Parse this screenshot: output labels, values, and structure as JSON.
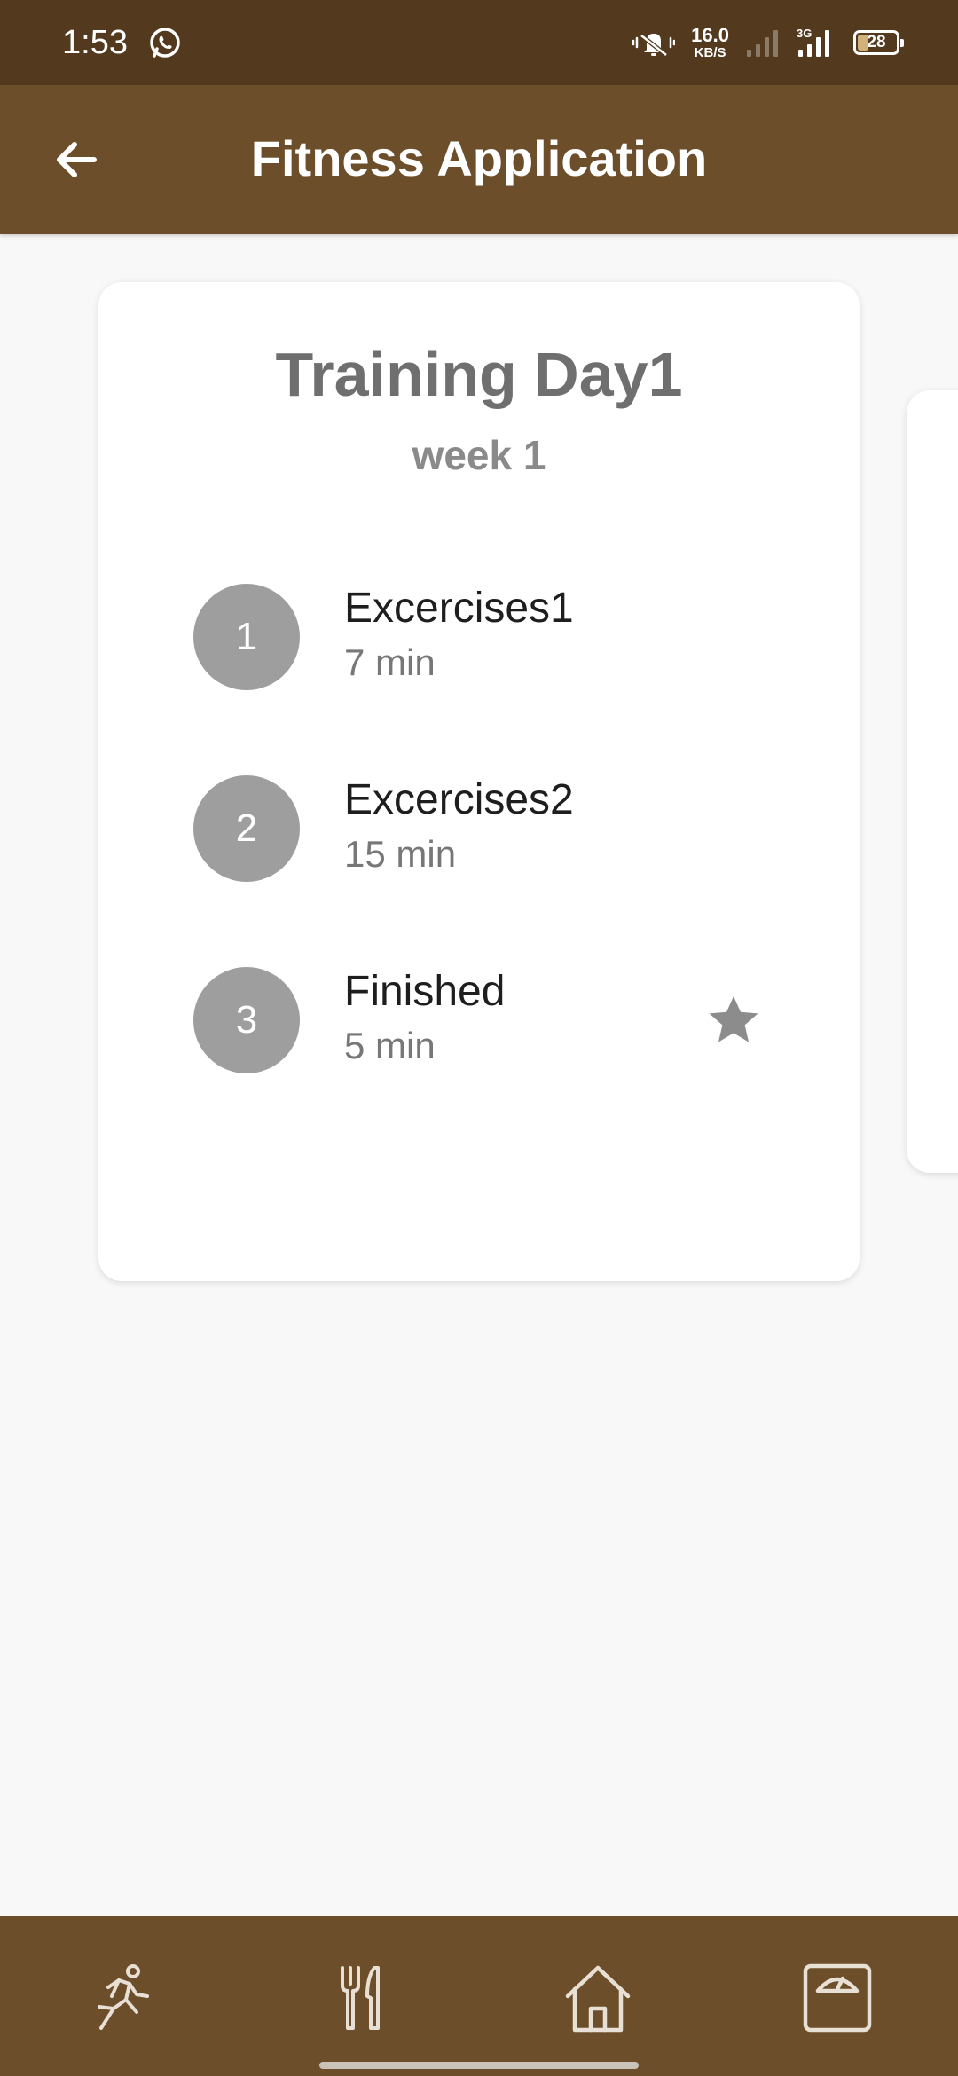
{
  "status_bar": {
    "time": "1:53",
    "network_speed_value": "16.0",
    "network_speed_unit": "KB/S",
    "network_type": "3G",
    "battery_level": "28",
    "battery_fraction": 0.28
  },
  "app_bar": {
    "title": "Fitness Application"
  },
  "card": {
    "title": "Training Day1",
    "subtitle": "week 1",
    "exercises": [
      {
        "number": "1",
        "name": "Excercises1",
        "duration": "7 min",
        "starred": false
      },
      {
        "number": "2",
        "name": "Excercises2",
        "duration": "15 min",
        "starred": false
      },
      {
        "number": "3",
        "name": "Finished",
        "duration": "5 min",
        "starred": true
      }
    ]
  },
  "bottom_nav": {
    "items": [
      {
        "icon": "running-icon"
      },
      {
        "icon": "fork-knife-icon"
      },
      {
        "icon": "home-icon"
      },
      {
        "icon": "scale-icon"
      }
    ]
  },
  "colors": {
    "status_bar": "#533a1f",
    "app_bar": "#6d4e2a",
    "bottom_nav": "#6d4e2a",
    "circle": "#9e9e9e",
    "background": "#f8f8f8",
    "nav_icon": "#e8e0d4"
  }
}
